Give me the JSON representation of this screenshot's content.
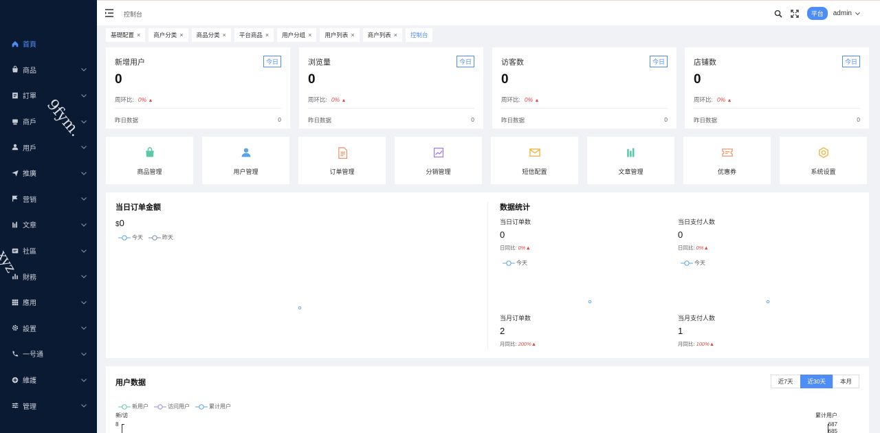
{
  "sidebar": {
    "items": [
      {
        "label": "首頁",
        "icon": "home-icon",
        "active": true,
        "expandable": false
      },
      {
        "label": "商品",
        "icon": "bag-icon",
        "active": false,
        "expandable": true
      },
      {
        "label": "訂單",
        "icon": "order-icon",
        "active": false,
        "expandable": true
      },
      {
        "label": "商戶",
        "icon": "shop-icon",
        "active": false,
        "expandable": true
      },
      {
        "label": "用戶",
        "icon": "user-icon",
        "active": false,
        "expandable": true
      },
      {
        "label": "推廣",
        "icon": "send-icon",
        "active": false,
        "expandable": true
      },
      {
        "label": "营销",
        "icon": "flag-icon",
        "active": false,
        "expandable": true
      },
      {
        "label": "文章",
        "icon": "article-icon",
        "active": false,
        "expandable": true
      },
      {
        "label": "社區",
        "icon": "community-icon",
        "active": false,
        "expandable": true
      },
      {
        "label": "財務",
        "icon": "finance-icon",
        "active": false,
        "expandable": true
      },
      {
        "label": "應用",
        "icon": "apps-icon",
        "active": false,
        "expandable": true
      },
      {
        "label": "設置",
        "icon": "gear-icon",
        "active": false,
        "expandable": true
      },
      {
        "label": "一号通",
        "icon": "phone-icon",
        "active": false,
        "expandable": true
      },
      {
        "label": "維護",
        "icon": "maintain-icon",
        "active": false,
        "expandable": true
      },
      {
        "label": "管理",
        "icon": "sliders-icon",
        "active": false,
        "expandable": true
      }
    ]
  },
  "header": {
    "breadcrumb": "控制台",
    "platform_badge": "平台",
    "user": "admin"
  },
  "tabs": [
    {
      "label": "基礎配置",
      "closable": true,
      "active": false
    },
    {
      "label": "商户分类",
      "closable": true,
      "active": false
    },
    {
      "label": "商品分类",
      "closable": true,
      "active": false
    },
    {
      "label": "平台商品",
      "closable": true,
      "active": false
    },
    {
      "label": "用户分组",
      "closable": true,
      "active": false
    },
    {
      "label": "用户列表",
      "closable": true,
      "active": false
    },
    {
      "label": "商户列表",
      "closable": true,
      "active": false
    },
    {
      "label": "控制台",
      "closable": false,
      "active": true
    }
  ],
  "close_glyph": "×",
  "stats": [
    {
      "title": "新增用户",
      "badge": "今日",
      "value": "0",
      "ratio_label": "周环比:",
      "ratio": "0%",
      "yesterday_label": "昨日数据",
      "yesterday": "0"
    },
    {
      "title": "浏览量",
      "badge": "今日",
      "value": "0",
      "ratio_label": "周环比:",
      "ratio": "0%",
      "yesterday_label": "昨日数据",
      "yesterday": "0"
    },
    {
      "title": "访客数",
      "badge": "今日",
      "value": "0",
      "ratio_label": "周环比:",
      "ratio": "0%",
      "yesterday_label": "昨日数据",
      "yesterday": "0"
    },
    {
      "title": "店铺数",
      "badge": "今日",
      "value": "0",
      "ratio_label": "周环比:",
      "ratio": "0%",
      "yesterday_label": "昨日数据",
      "yesterday": "0"
    }
  ],
  "quick_links": [
    {
      "label": "商品管理",
      "icon": "bag-icon",
      "color": "#5cc8a8"
    },
    {
      "label": "用户管理",
      "icon": "user-icon",
      "color": "#5aa5e8"
    },
    {
      "label": "订单管理",
      "icon": "document-icon",
      "color": "#f0956a"
    },
    {
      "label": "分销管理",
      "icon": "trend-icon",
      "color": "#a57be0"
    },
    {
      "label": "短信配置",
      "icon": "mail-icon",
      "color": "#f2b545"
    },
    {
      "label": "文章管理",
      "icon": "article-icon",
      "color": "#5cc8a8"
    },
    {
      "label": "优惠券",
      "icon": "coupon-icon",
      "color": "#f0956a"
    },
    {
      "label": "系统设置",
      "icon": "settings-icon",
      "color": "#f2b545"
    }
  ],
  "order_amount": {
    "title": "当日订单金额",
    "currency": "$",
    "value": "0",
    "legend": [
      "今天",
      "昨天"
    ]
  },
  "data_stats": {
    "title": "数据统计",
    "blocks": [
      {
        "label": "当日订单数",
        "value": "0",
        "ratio_label": "日同比:",
        "ratio": "0%",
        "legend": "今天"
      },
      {
        "label": "当日支付人数",
        "value": "0",
        "ratio_label": "日同比:",
        "ratio": "0%",
        "legend": "今天"
      },
      {
        "label": "当月订单数",
        "value": "2",
        "ratio_label": "月同比:",
        "ratio": "200%"
      },
      {
        "label": "当月支付人数",
        "value": "1",
        "ratio_label": "月同比:",
        "ratio": "100%"
      }
    ]
  },
  "user_data": {
    "title": "用户数据",
    "ranges": [
      {
        "label": "近7天",
        "active": false
      },
      {
        "label": "近30天",
        "active": true
      },
      {
        "label": "本月",
        "active": false
      }
    ],
    "legend": [
      "新用户",
      "访问用户",
      "累计用户"
    ],
    "left_axis_title": "新/访",
    "right_axis_title": "累计用户",
    "left_tick": "8",
    "right_ticks": [
      "687",
      "685"
    ]
  },
  "watermarks": [
    "9fym.",
    "xyz"
  ],
  "colors": {
    "sidebar_bg": "#0b1a33",
    "accent": "#4f8df6",
    "up": "#e64545",
    "series_new": "#5cc8a8",
    "series_visit": "#9b8ae6",
    "series_total": "#5aa5e8"
  }
}
